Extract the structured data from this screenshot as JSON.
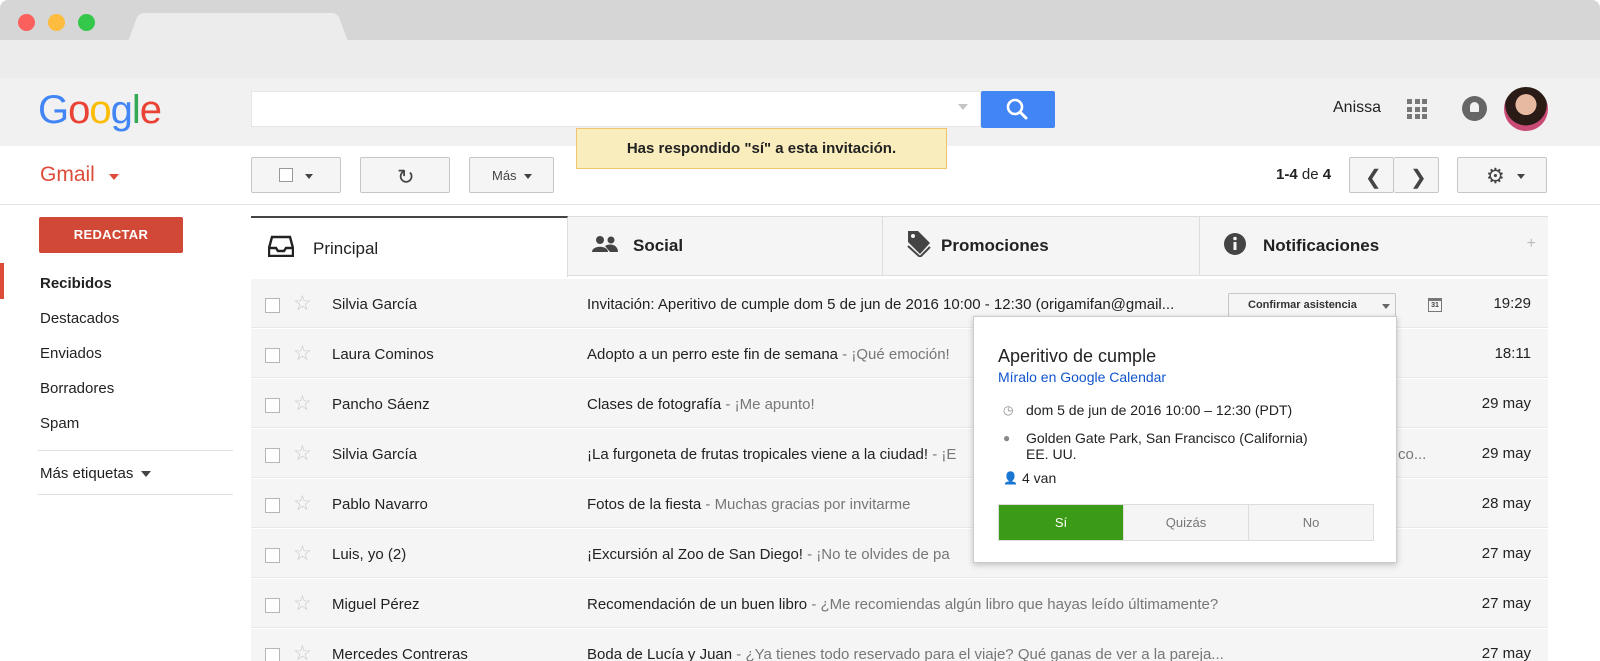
{
  "header": {
    "logo": [
      "G",
      "o",
      "o",
      "g",
      "l",
      "e"
    ],
    "logo_colors": [
      "#4285f4",
      "#ea4335",
      "#fbbc05",
      "#4285f4",
      "#34a853",
      "#ea4335"
    ],
    "search_placeholder": "",
    "username": "Anissa"
  },
  "toolbar": {
    "app_label": "Gmail",
    "more_label": "Más",
    "notice": "Has respondido \"sí\" a esta invitación.",
    "page_range": "1-4",
    "page_of": "de",
    "page_total": "4"
  },
  "sidebar": {
    "compose": "REDACTAR",
    "items": [
      {
        "label": "Recibidos",
        "active": true
      },
      {
        "label": "Destacados"
      },
      {
        "label": "Enviados"
      },
      {
        "label": "Borradores"
      },
      {
        "label": "Spam"
      }
    ],
    "more_labels": "Más etiquetas"
  },
  "tabs": [
    {
      "label": "Principal",
      "icon": "inbox-icon",
      "active": true
    },
    {
      "label": "Social",
      "icon": "people-icon"
    },
    {
      "label": "Promociones",
      "icon": "tag-icon"
    },
    {
      "label": "Notificaciones",
      "icon": "info-icon"
    }
  ],
  "emails": [
    {
      "sender": "Silvia García",
      "subject": "Invitación: Aperitivo de cumple dom 5 de jun de 2016 10:00 - 12:30 (origamifan@gmail...",
      "snippet": "",
      "date": "19:29",
      "rsvp": "Confirmar asistencia",
      "cal_day": "31"
    },
    {
      "sender": "Laura Cominos",
      "subject": "Adopto a un perro este fin de semana",
      "snippet": " - ¡Qué emoción!",
      "date": "18:11"
    },
    {
      "sender": "Pancho Sáenz",
      "subject": "Clases de fotografía",
      "snippet": " - ¡Me apunto!",
      "date": "29 may"
    },
    {
      "sender": "Silvia García",
      "subject": "¡La furgoneta de frutas tropicales viene a la ciudad!",
      "snippet": " - ¡E",
      "tail": "co...",
      "date": "29 may"
    },
    {
      "sender": "Pablo Navarro",
      "subject": "Fotos de la fiesta",
      "snippet": " - Muchas gracias por invitarme",
      "date": "28 may"
    },
    {
      "sender": "Luis, yo (2)",
      "subject": "¡Excursión al Zoo de San Diego!",
      "snippet": " - ¡No te olvides de pa",
      "date": "27 may"
    },
    {
      "sender": "Miguel Pérez",
      "subject": "Recomendación de un buen libro",
      "snippet": " - ¿Me recomiendas algún libro que hayas leído últimamente?",
      "date": "27 may"
    },
    {
      "sender": "Mercedes Contreras",
      "subject": "Boda de Lucía y Juan",
      "snippet": " - ¿Ya tienes todo reservado para el viaje? Qué ganas de ver a la pareja...",
      "date": "27 may"
    }
  ],
  "popup": {
    "title": "Aperitivo de cumple",
    "calendar_link": "Míralo en Google Calendar",
    "when": "dom 5 de jun de 2016 10:00 – 12:30 (PDT)",
    "where_line1": "Golden Gate Park, San Francisco (California)",
    "where_line2": "EE. UU.",
    "guests": "4 van",
    "options": [
      "Sí",
      "Quizás",
      "No"
    ],
    "selected": "Sí"
  },
  "colors": {
    "accent_red": "#dd4b39",
    "compose_red": "#d14836",
    "search_blue": "#4285f4",
    "rsvp_green": "#3b9a16",
    "link_blue": "#1155cc"
  }
}
